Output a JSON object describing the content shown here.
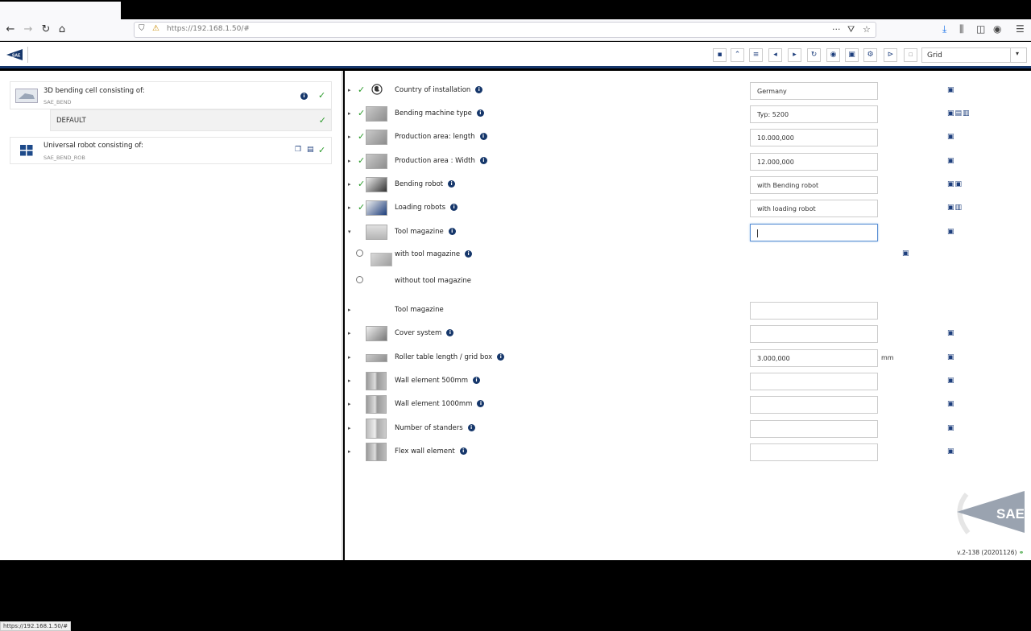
{
  "browser": {
    "url": "https://192.168.1.50/#",
    "status_url": "https://192.168.1.50/#"
  },
  "header": {
    "logo_text": "SAE",
    "view_select": {
      "value": "Grid"
    }
  },
  "left": {
    "cards": [
      {
        "title": "3D bending cell consisting of:",
        "subtitle": "SAE_BEND"
      },
      {
        "title": "Universal robot consisting of:",
        "subtitle": "SAE_BEND_ROB"
      }
    ],
    "default_label": "DEFAULT"
  },
  "config": {
    "rows": [
      {
        "label": "Country of installation",
        "value": "Germany",
        "checked": true
      },
      {
        "label": "Bending machine type",
        "value": "Typ: 5200",
        "checked": true
      },
      {
        "label": "Production area: length",
        "value": "10.000,000",
        "checked": true
      },
      {
        "label": "Production area : Width",
        "value": "12.000,000",
        "checked": true
      },
      {
        "label": "Bending robot",
        "value": "with Bending robot",
        "checked": true
      },
      {
        "label": "Loading robots",
        "value": "with loading robot",
        "checked": true
      },
      {
        "label": "Tool magazine",
        "value": "",
        "checked": false,
        "expanded": true
      }
    ],
    "options": [
      {
        "label": "with tool magazine"
      },
      {
        "label": "without tool magazine"
      }
    ],
    "rows2": [
      {
        "label": "Tool magazine",
        "value": ""
      },
      {
        "label": "Cover system",
        "value": ""
      },
      {
        "label": "Roller table length / grid box",
        "value": "3.000,000",
        "unit": "mm"
      },
      {
        "label": "Wall element 500mm",
        "value": ""
      },
      {
        "label": "Wall element 1000mm",
        "value": ""
      },
      {
        "label": "Number of standers",
        "value": ""
      },
      {
        "label": "Flex wall element",
        "value": ""
      }
    ]
  },
  "footer": {
    "version": "v.2-138 (20201126)"
  },
  "colors": {
    "brand": "#16376b",
    "check": "#2a9a2a"
  }
}
